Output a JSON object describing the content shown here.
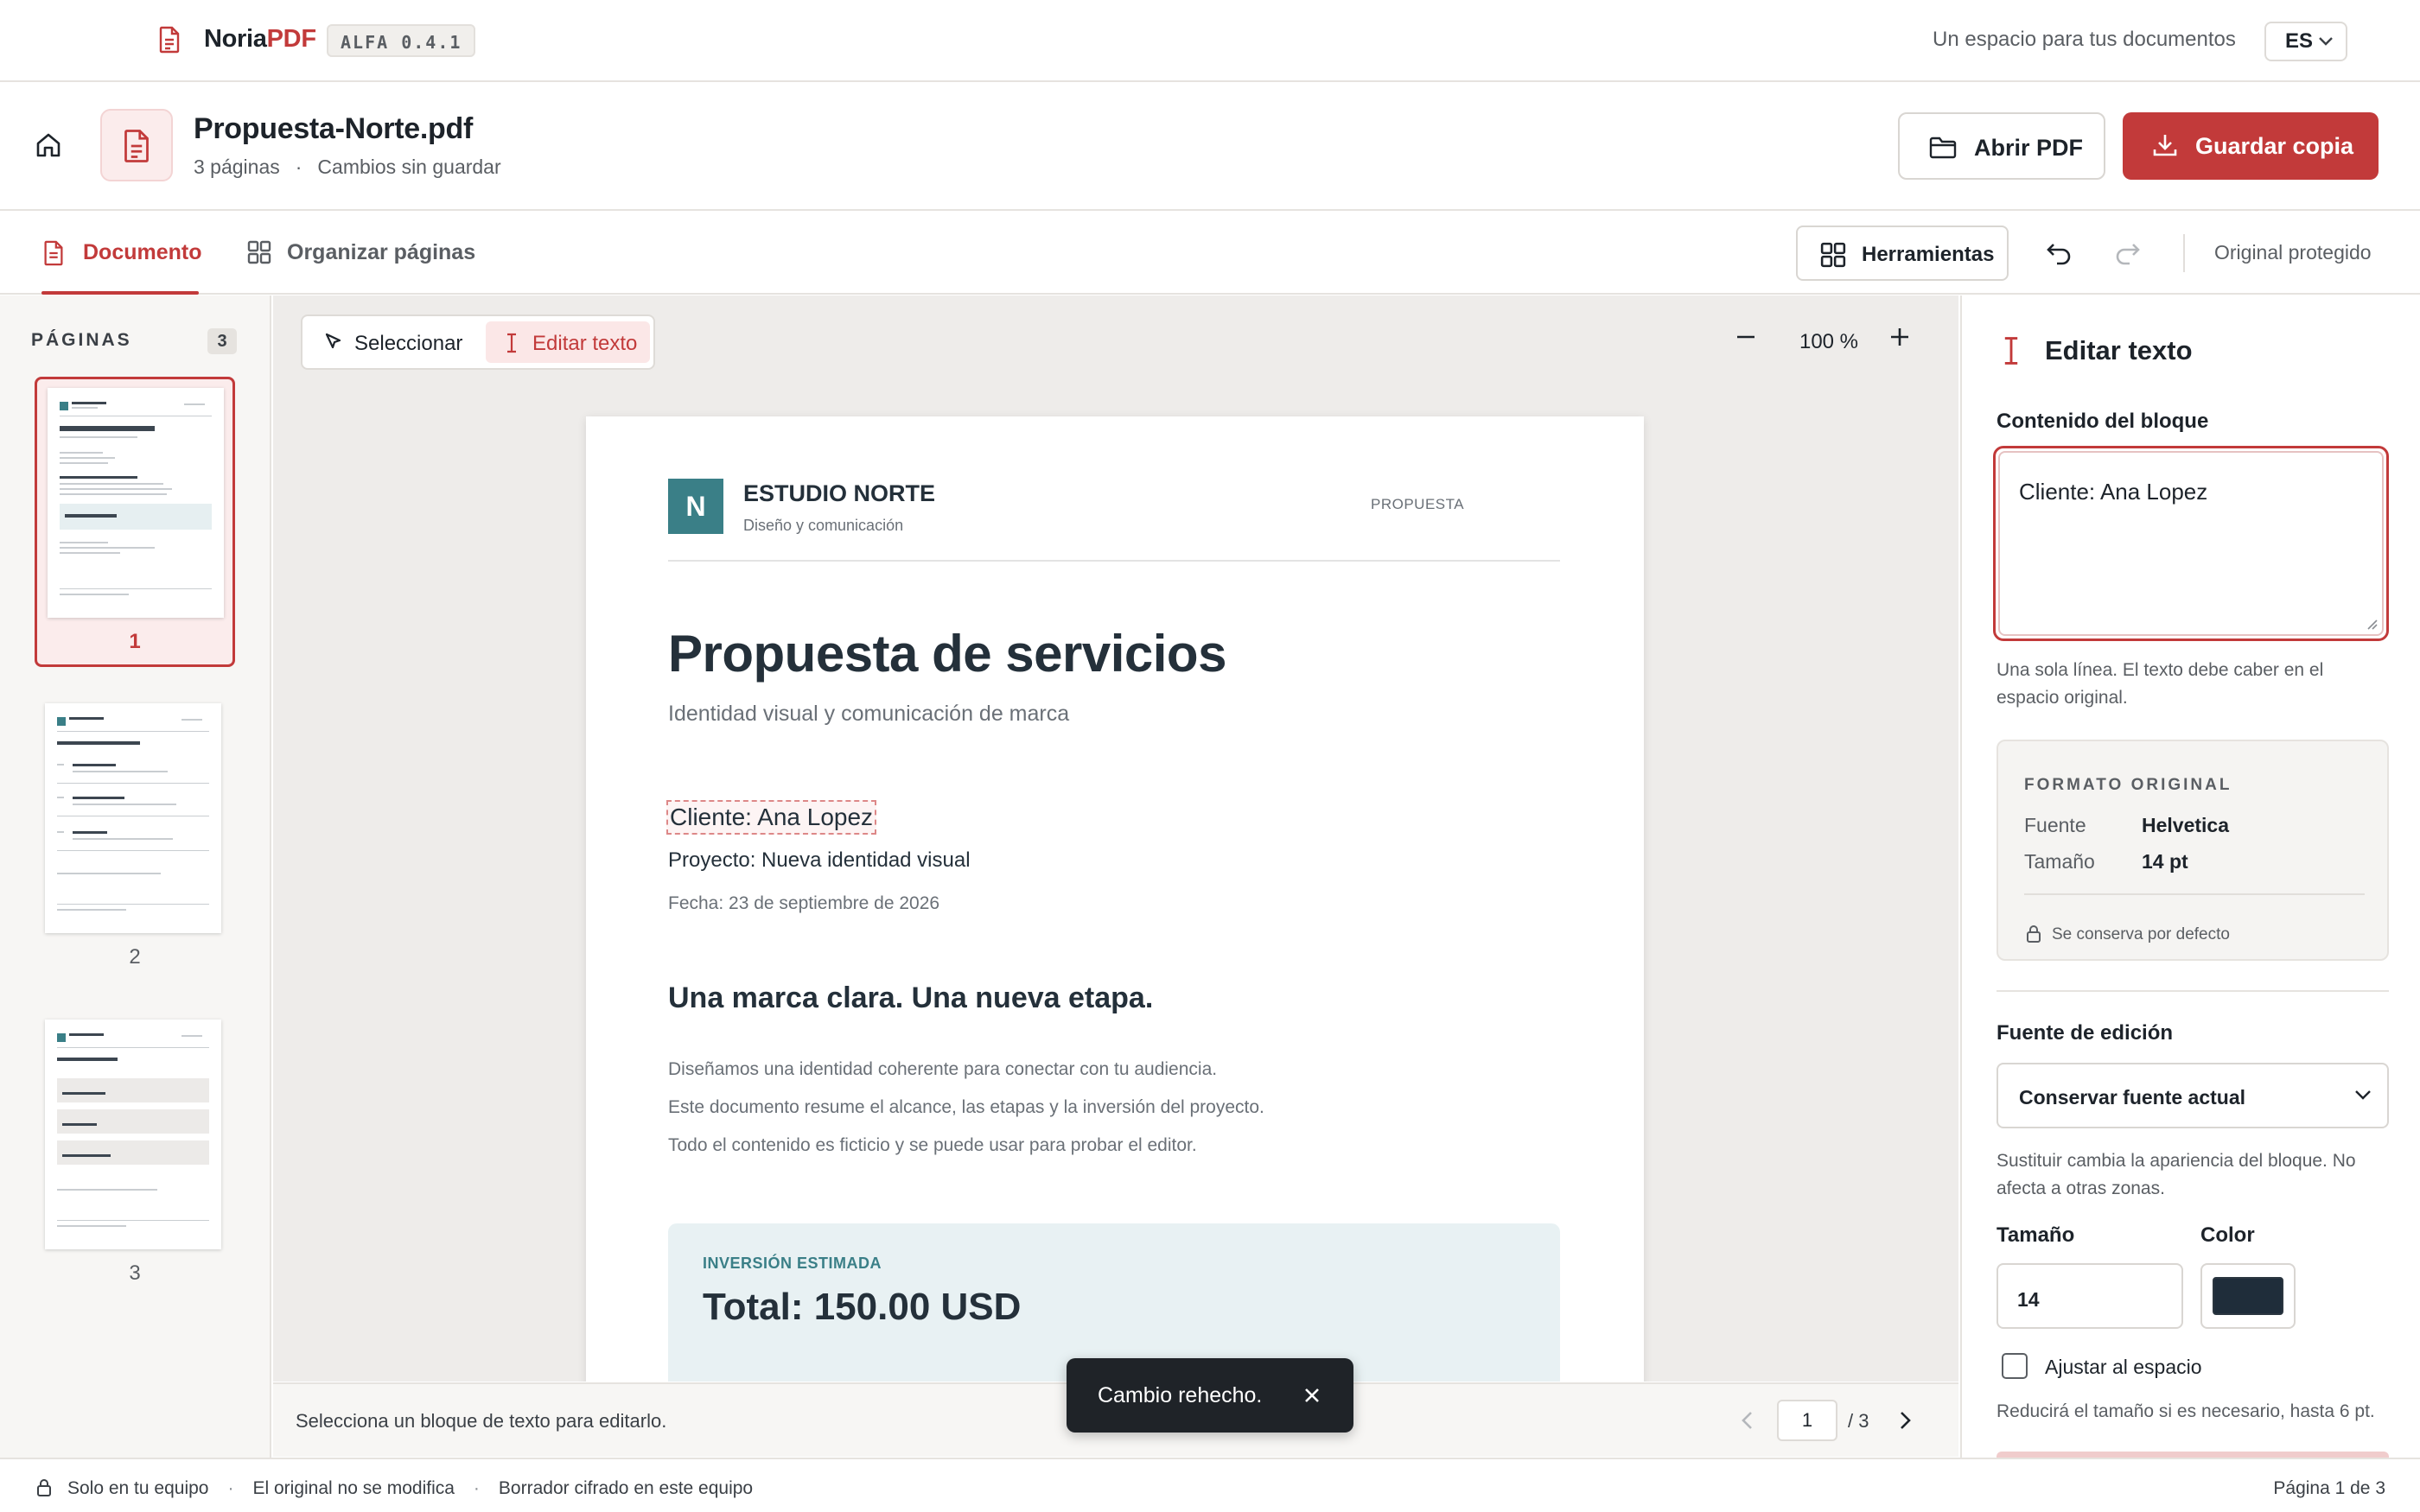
{
  "app": {
    "brand_prefix": "Noria",
    "brand_suffix": "PDF",
    "version": "ALFA 0.4.1",
    "tagline": "Un espacio para tus documentos",
    "language": "ES",
    "accent_color": "#c23a3a"
  },
  "doc": {
    "file_name": "Propuesta-Norte.pdf",
    "pages_label": "3 páginas",
    "separator": "·",
    "status": "Cambios sin guardar",
    "open_label": "Abrir PDF",
    "save_label": "Guardar copia"
  },
  "tabs": [
    {
      "label": "Documento",
      "active": true,
      "icon": "document-icon"
    },
    {
      "label": "Organizar páginas",
      "active": false,
      "icon": "grid-icon"
    }
  ],
  "toolbar": {
    "tools_label": "Herramientas",
    "protected_label": "Original protegido"
  },
  "sidebar": {
    "title": "PÁGINAS",
    "count": "3",
    "thumbnails": [
      {
        "number": "1",
        "selected": true
      },
      {
        "number": "2",
        "selected": false
      },
      {
        "number": "3",
        "selected": false
      }
    ]
  },
  "canvas": {
    "modes": [
      {
        "label": "Seleccionar",
        "active": false
      },
      {
        "label": "Editar texto",
        "active": true
      }
    ],
    "zoom": "100 %",
    "hint": "Selecciona un bloque de texto para editarlo.",
    "current_page": "1",
    "page_total": "/ 3"
  },
  "pdf": {
    "logo_letter": "N",
    "studio_name": "ESTUDIO NORTE",
    "studio_sub": "Diseño y comunicación",
    "doc_kind": "PROPUESTA",
    "title": "Propuesta de servicios",
    "subtitle": "Identidad visual y comunicación de marca",
    "client": "Cliente: Ana Lopez",
    "project": "Proyecto: Nueva identidad visual",
    "date": "Fecha: 23 de septiembre de 2026",
    "heading": "Una marca clara. Una nueva etapa.",
    "paragraphs": [
      "Diseñamos una identidad coherente para conectar con tu audiencia.",
      "Este documento resume el alcance, las etapas y la inversión del proyecto.",
      "Todo el contenido es ficticio y se puede usar para probar el editor."
    ],
    "invest_label": "INVERSIÓN ESTIMADA",
    "invest_total": "Total: 150.00 USD"
  },
  "toast": {
    "message": "Cambio rehecho."
  },
  "panel": {
    "title": "Editar texto",
    "content_label": "Contenido del bloque",
    "content_value": "Cliente: Ana Lopez",
    "content_hint": "Una sola línea. El texto debe caber en el espacio original.",
    "original_title": "FORMATO ORIGINAL",
    "font_key": "Fuente",
    "font_value": "Helvetica",
    "size_key": "Tamaño",
    "size_value": "14 pt",
    "preserve_note": "Se conserva por defecto",
    "edit_font_label": "Fuente de edición",
    "edit_font_value": "Conservar fuente actual",
    "edit_font_hint": "Sustituir cambia la apariencia del bloque. No afecta a otras zonas.",
    "size_label": "Tamaño",
    "size_input": "14",
    "color_label": "Color",
    "color_value": "#1f2d3a",
    "fit_label": "Ajustar al espacio",
    "fit_checked": false,
    "fit_hint": "Reducirá el tamaño si es necesario, hasta 6 pt."
  },
  "statusbar": {
    "items": [
      "Solo en tu equipo",
      "El original no se modifica",
      "Borrador cifrado en este equipo"
    ],
    "separator": "·",
    "page_status": "Página 1 de 3"
  }
}
